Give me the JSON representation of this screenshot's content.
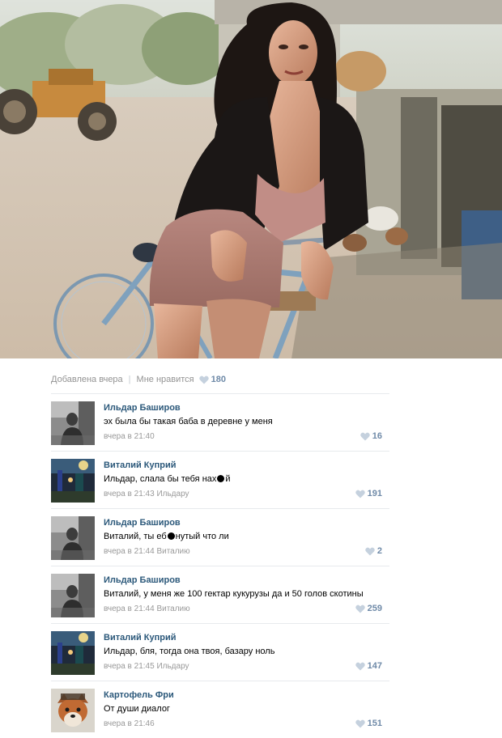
{
  "post": {
    "added_label": "Добавлена вчера",
    "separator": "|",
    "like_label": "Мне нравится",
    "like_count": "180"
  },
  "icons": {
    "heart": "heart-icon",
    "heart_color": "#c5d1de"
  },
  "colors": {
    "author_link": "#2b587a",
    "meta_text": "#939393",
    "like_count": "#6f8aa8",
    "divider": "#e7eaed"
  },
  "comments": [
    {
      "author": "Ильдар Баширов",
      "text_before": "эх была бы такая баба в деревне у меня",
      "text_after": "",
      "time": "вчера в 21:40",
      "reply_to": "",
      "likes": "16",
      "avatar": "man-bw"
    },
    {
      "author": "Виталий Куприй",
      "text_before": "Ильдар, слала бы тебя нах",
      "text_after": "й",
      "time": "вчера в 21:43",
      "reply_to": "Ильдару",
      "likes": "191",
      "avatar": "night-street"
    },
    {
      "author": "Ильдар Баширов",
      "text_before": "Виталий, ты еб",
      "text_after": "нутый что ли",
      "time": "вчера в 21:44",
      "reply_to": "Виталию",
      "likes": "2",
      "avatar": "man-bw"
    },
    {
      "author": "Ильдар Баширов",
      "text_before": "Виталий, у меня же 100 гектар кукурузы да и 50 голов скотины",
      "text_after": "",
      "time": "вчера в 21:44",
      "reply_to": "Виталию",
      "likes": "259",
      "avatar": "man-bw"
    },
    {
      "author": "Виталий Куприй",
      "text_before": "Ильдар, бля, тогда она твоя, базару ноль",
      "text_after": "",
      "time": "вчера в 21:45",
      "reply_to": "Ильдару",
      "likes": "147",
      "avatar": "night-street"
    },
    {
      "author": "Картофель Фри",
      "text_before": "От души диалог",
      "text_after": "",
      "time": "вчера в 21:46",
      "reply_to": "",
      "likes": "151",
      "avatar": "fox"
    }
  ]
}
